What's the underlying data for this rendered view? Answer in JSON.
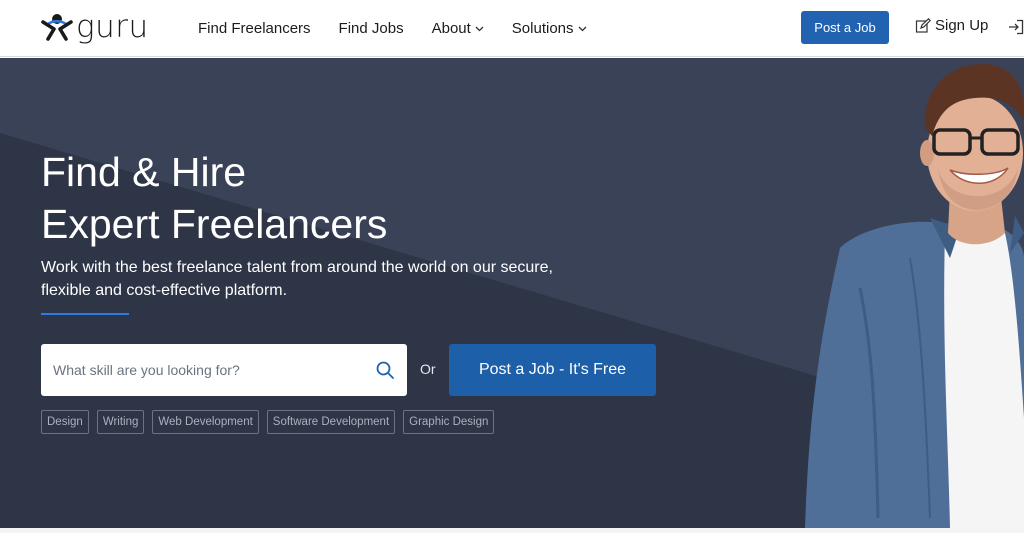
{
  "header": {
    "logo_text": "guru",
    "nav": [
      {
        "label": "Find Freelancers",
        "has_caret": false
      },
      {
        "label": "Find Jobs",
        "has_caret": false
      },
      {
        "label": "About",
        "has_caret": true
      },
      {
        "label": "Solutions",
        "has_caret": true
      }
    ],
    "post_job_label": "Post a Job",
    "signup_label": "Sign Up",
    "icons": {
      "signup": "edit-icon",
      "login": "login-icon",
      "caret": "chevron-down-icon"
    }
  },
  "hero": {
    "title_line1": "Find & Hire",
    "title_line2": "Expert Freelancers",
    "subtitle_line1": "Work with the best freelance talent from around the world on our secure,",
    "subtitle_line2": "flexible and cost-effective platform.",
    "search": {
      "placeholder": "What skill are you looking for?",
      "value": "",
      "icon": "search-icon"
    },
    "or_label": "Or",
    "cta_label": "Post a Job - It's Free",
    "tags": [
      "Design",
      "Writing",
      "Web Development",
      "Software Development",
      "Graphic Design"
    ]
  },
  "colors": {
    "brand_blue": "#2163b0",
    "hero_bg": "#2e3546",
    "accent_rule": "#2c7be5"
  }
}
